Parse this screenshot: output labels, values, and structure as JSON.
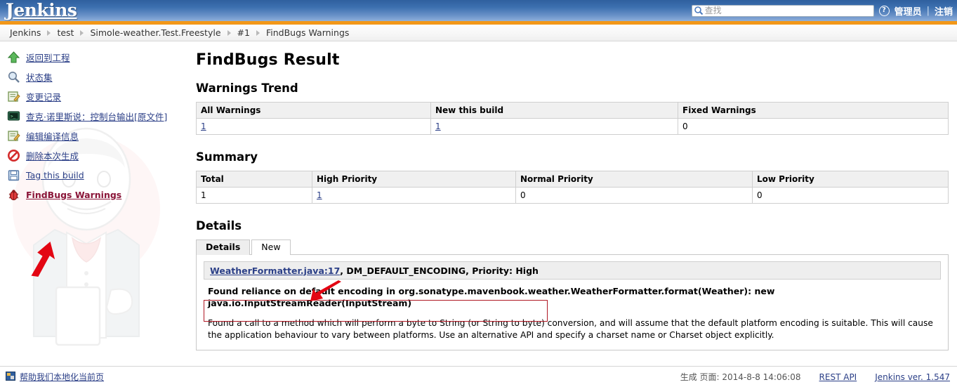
{
  "header": {
    "logo": "Jenkins",
    "search_placeholder": "查找",
    "help_icon": "?",
    "user_label": "管理员",
    "separator": "|",
    "logout_label": "注销"
  },
  "breadcrumb": {
    "items": [
      {
        "label": "Jenkins"
      },
      {
        "label": "test"
      },
      {
        "label": "Simole-weather.Test.Freestyle"
      },
      {
        "label": "#1"
      },
      {
        "label": "FindBugs Warnings"
      }
    ]
  },
  "sidebar": {
    "items": [
      {
        "label": "返回到工程",
        "icon": "up-arrow-icon",
        "bold": false
      },
      {
        "label": "状态集",
        "icon": "magnifier-icon",
        "bold": false
      },
      {
        "label": "变更记录",
        "icon": "edit-note-icon",
        "bold": false
      },
      {
        "label": "查克·诺里斯说：控制台输出",
        "suffix": "[原文件]",
        "icon": "console-icon",
        "bold": false
      },
      {
        "label": "编辑编译信息",
        "icon": "edit-note-icon",
        "bold": false
      },
      {
        "label": "删除本次生成",
        "icon": "no-entry-icon",
        "bold": false
      },
      {
        "label": "Tag this build",
        "icon": "floppy-disk-icon",
        "bold": false
      },
      {
        "label": "FindBugs Warnings",
        "icon": "bug-icon",
        "bold": true
      }
    ]
  },
  "main": {
    "page_title": "FindBugs Result",
    "trend": {
      "heading": "Warnings Trend",
      "columns": [
        "All Warnings",
        "New this build",
        "Fixed Warnings"
      ],
      "row": [
        {
          "value": "1",
          "link": true
        },
        {
          "value": "1",
          "link": true
        },
        {
          "value": "0",
          "link": false
        }
      ]
    },
    "summary": {
      "heading": "Summary",
      "columns": [
        "Total",
        "High Priority",
        "Normal Priority",
        "Low Priority"
      ],
      "row": [
        {
          "value": "1",
          "link": false
        },
        {
          "value": "1",
          "link": true
        },
        {
          "value": "0",
          "link": false
        },
        {
          "value": "0",
          "link": false
        }
      ]
    },
    "details": {
      "heading": "Details",
      "tabs": [
        {
          "label": "Details",
          "active": true
        },
        {
          "label": "New",
          "active": false
        }
      ],
      "warning": {
        "file_link": "WeatherFormatter.java:17",
        "meta": ", DM_DEFAULT_ENCODING, Priority: High",
        "description_bold": "Found reliance on default encoding in org.sonatype.mavenbook.weather.WeatherFormatter.format(Weather): new java.io.InputStreamReader(InputStream)",
        "description_text": "Found a call to a method which will perform a byte to String (or String to byte) conversion, and will assume that the default platform encoding is suitable. This will cause the application behaviour to vary between platforms. Use an alternative API and specify a charset name or Charset object explicitly."
      }
    }
  },
  "footer": {
    "localize_label": "帮助我们本地化当前页",
    "generated": "生成 页面: 2014-8-8 14:06:08",
    "rest_api": "REST API",
    "version": "Jenkins ver. 1.547"
  },
  "colors": {
    "header_blue": "#3d70b0",
    "orange_bar": "#f29718",
    "link_blue": "#2b3f87",
    "annotation_red": "#cc0000",
    "annotation_box": "#b01824"
  }
}
